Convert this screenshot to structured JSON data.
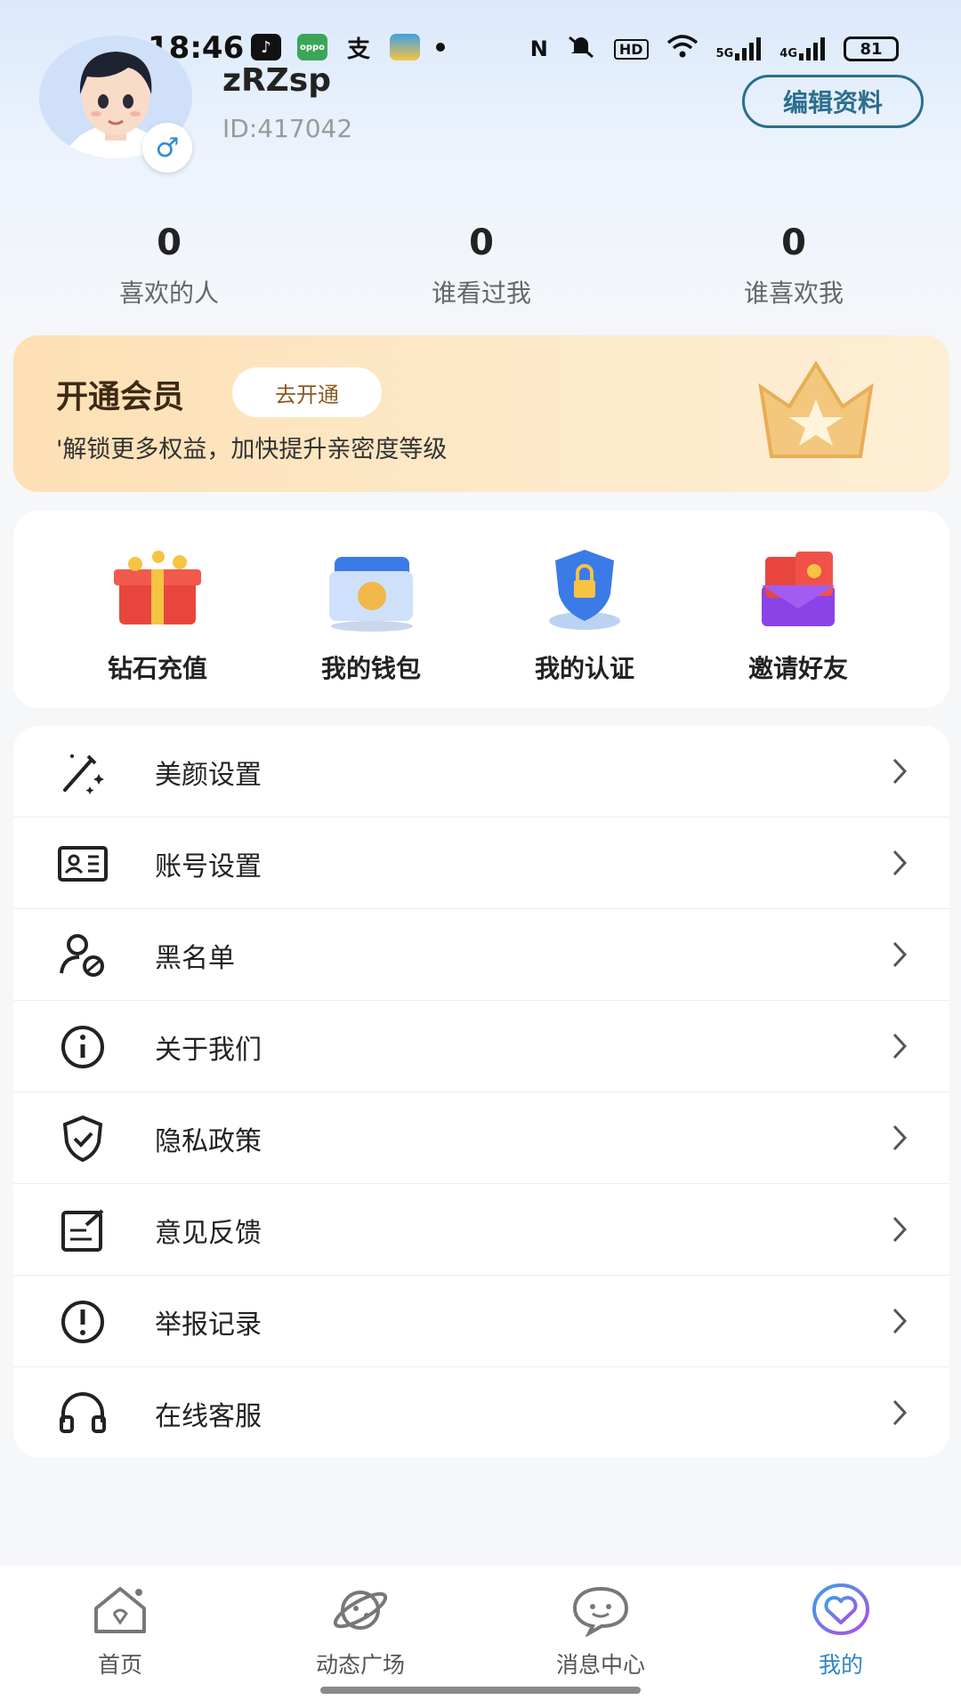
{
  "status_bar": {
    "time": "18:46",
    "battery": "81",
    "icons": [
      "tiktok-icon",
      "oppo-icon",
      "alipay-icon",
      "wallet-icon",
      "nfc-icon",
      "mute-icon",
      "hd-icon",
      "wifi-icon",
      "5g-signal-icon",
      "4g-signal-icon"
    ],
    "net_5g": "5G",
    "net_4g": "4G",
    "hd": "HD"
  },
  "profile": {
    "username": "zRZsp",
    "user_id": "ID:417042",
    "gender_symbol": "♂",
    "edit_label": "编辑资料"
  },
  "stats": [
    {
      "value": "0",
      "label": "喜欢的人"
    },
    {
      "value": "0",
      "label": "谁看过我"
    },
    {
      "value": "0",
      "label": "谁喜欢我"
    }
  ],
  "vip": {
    "title": "开通会员",
    "button": "去开通",
    "description": "'解锁更多权益，加快提升亲密度等级"
  },
  "features": [
    {
      "label": "钻石充值",
      "icon": "gift-box-icon"
    },
    {
      "label": "我的钱包",
      "icon": "wallet-folder-icon"
    },
    {
      "label": "我的认证",
      "icon": "shield-lock-icon"
    },
    {
      "label": "邀请好友",
      "icon": "red-envelope-icon"
    }
  ],
  "menu": [
    {
      "label": "美颜设置",
      "icon": "magic-wand-icon"
    },
    {
      "label": "账号设置",
      "icon": "id-card-icon"
    },
    {
      "label": "黑名单",
      "icon": "user-block-icon"
    },
    {
      "label": "关于我们",
      "icon": "info-icon"
    },
    {
      "label": "隐私政策",
      "icon": "shield-check-icon"
    },
    {
      "label": "意见反馈",
      "icon": "feedback-icon"
    },
    {
      "label": "举报记录",
      "icon": "alert-icon"
    },
    {
      "label": "在线客服",
      "icon": "headset-icon"
    }
  ],
  "bottom_nav": [
    {
      "label": "首页",
      "icon": "home-icon"
    },
    {
      "label": "动态广场",
      "icon": "planet-icon"
    },
    {
      "label": "消息中心",
      "icon": "chat-icon"
    },
    {
      "label": "我的",
      "icon": "heart-icon",
      "active": true
    }
  ],
  "colors": {
    "accent": "#2f86c8",
    "edit_border": "#2b6e8f",
    "vip_text": "#3d2a14"
  }
}
